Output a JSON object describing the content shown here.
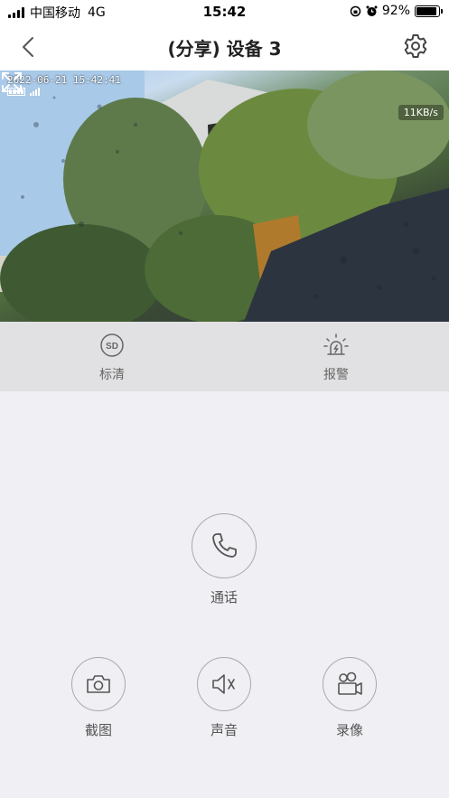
{
  "status_bar": {
    "carrier": "中国移动",
    "network": "4G",
    "time": "15:42",
    "battery_percent": "92%",
    "battery_level": 0.92
  },
  "nav": {
    "title": "(分享) 设备 3",
    "back_icon": "chevron-left-icon",
    "settings_icon": "gear-icon"
  },
  "video": {
    "timestamp": "2022-06-21 15:42:41",
    "speed": "11KB/s",
    "fullscreen_icon": "expand-icon"
  },
  "toolbar": {
    "quality_label": "标清",
    "quality_icon": "sd-icon",
    "alarm_label": "报警",
    "alarm_icon": "siren-icon"
  },
  "controls": {
    "talk_label": "通话",
    "talk_icon": "phone-icon",
    "screenshot_label": "截图",
    "screenshot_icon": "camera-icon",
    "sound_label": "声音",
    "sound_icon": "speaker-muted-icon",
    "record_label": "录像",
    "record_icon": "video-camera-icon"
  },
  "colors": {
    "toolbar_bg": "#e1e1e3",
    "page_bg": "#f0f0f4",
    "icon_gray": "#666666"
  }
}
